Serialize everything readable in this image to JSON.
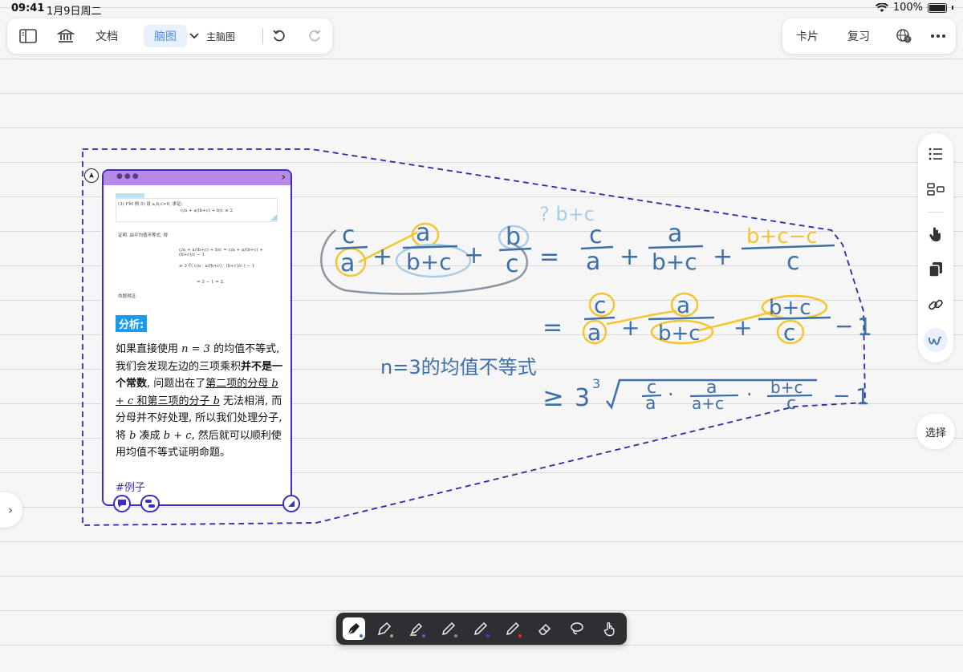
{
  "status_bar": {
    "time": "09:41",
    "date": "1月9日周二",
    "battery": "100%"
  },
  "toolbar": {
    "doc_label": "文档",
    "mindmap_label": "脑图",
    "main_mindmap_label": "主脑图",
    "card_label": "卡片",
    "review_label": "复习"
  },
  "card": {
    "analysis_tag": "分析:",
    "body_parts": {
      "p1": "如果直接使用 ",
      "m1": "n = 3",
      "p2": " 的均值不等式, 我们会发现左边的三项乘积",
      "b1": "并不是一个常数",
      "p3": ", 问题出在了",
      "u1": "第二项的分母 ",
      "m2": "b + c",
      "u2": " 和第三项的分子 ",
      "m3": "b",
      "p4": " 无法相消, 而分母并不好处理, 所以我们处理分子, 将 ",
      "m4": "b",
      "p5": " 凑成 ",
      "m5": "b + c",
      "p6": ", 然后就可以顺利使用均值不等式证明命题。"
    },
    "hashtag": "#例子",
    "image_text": {
      "line1": "(3) FM 例 5) 设 a,b,c>0, 求证:",
      "line2": "c/a + a/(b+c) + b/c ≥ 2",
      "line3": "证明. 由平均值不等式, 得",
      "line4": "c/a + a/(b+c) + b/c = c/a + a/(b+c) + (b+c)/c − 1",
      "line5": "≥ 3·∛( c/a · a/(b+c) · (b+c)/c ) − 1",
      "line6": "= 3 − 1 = 2.",
      "line7": "命题得证."
    }
  },
  "handwriting": {
    "question_note": "? b+c",
    "lhs_f1_num": "c",
    "lhs_f1_den": "a",
    "lhs_f2_num": "a",
    "lhs_f2_den": "b+c",
    "lhs_f3_num": "b",
    "lhs_f3_den": "c",
    "plus": "+",
    "minus": "−",
    "equals": "=",
    "rhs_f1_num": "c",
    "rhs_f1_den": "a",
    "rhs_f2_num": "a",
    "rhs_f2_den": "b+c",
    "rhs_f3_num": "b+c−c",
    "rhs_f3_den": "c",
    "line2_f1_num": "c",
    "line2_f1_den": "a",
    "line2_f2_num": "a",
    "line2_f2_den": "b+c",
    "line2_f3_num": "b+c",
    "line2_f3_den": "c",
    "one": "1",
    "note": "n=3的均值不等式",
    "geq": "≥",
    "three": "3",
    "cube_idx": "3",
    "line3_f1_num": "c",
    "line3_f1_den": "a",
    "line3_f2_num": "a",
    "line3_f2_den": "a+c",
    "line3_f3_num": "b+c",
    "line3_f3_den": "c",
    "dot": "·"
  },
  "sidebar": {
    "select_label": "选择"
  },
  "colors": {
    "ink_blue": "#3d6fa8",
    "highlight_yellow": "#f3c530",
    "highlight_light_blue": "#a9cde6",
    "lasso_gray": "#8a96a3",
    "selection": "#2a2aa8",
    "card_header": "#b68ae6",
    "analysis_tag": "#1a9bf0",
    "accent": "#4a90e2"
  },
  "icons": [
    "sidebar-toggle-icon",
    "library-icon",
    "chevron-down-icon",
    "undo-icon",
    "redo-icon",
    "translate-icon",
    "more-icon",
    "outline-icon",
    "layout-icon",
    "hand-icon",
    "copy-icon",
    "link-icon",
    "scribble-icon",
    "chevron-right-icon",
    "pen-icon",
    "fountain-pen-icon",
    "highlighter-icon",
    "pencil-icon",
    "eraser-icon",
    "lasso-icon",
    "touch-icon"
  ]
}
